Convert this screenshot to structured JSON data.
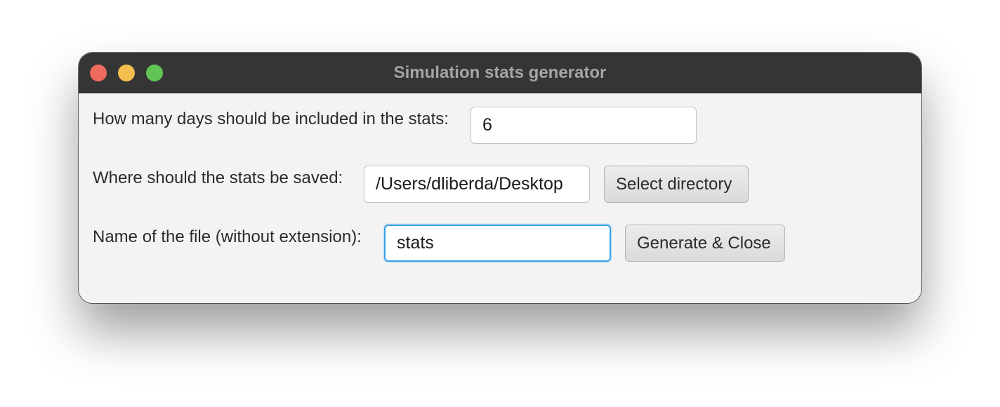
{
  "window": {
    "title": "Simulation stats generator"
  },
  "form": {
    "days": {
      "label": "How many days should be included in the stats:",
      "value": "6"
    },
    "directory": {
      "label": "Where should the stats be saved:",
      "value": "/Users/dliberda/Desktop",
      "button_label": "Select directory"
    },
    "filename": {
      "label": "Name of the file (without extension):",
      "value": "stats",
      "focused": true
    },
    "generate_button_label": "Generate & Close"
  },
  "colors": {
    "titlebar": "#353535",
    "window_background": "#f3f3f3",
    "close_light": "#ec6a5e",
    "minimize_light": "#f4bf4f",
    "zoom_light": "#61c454",
    "focus_ring": "#3aa0e6"
  }
}
